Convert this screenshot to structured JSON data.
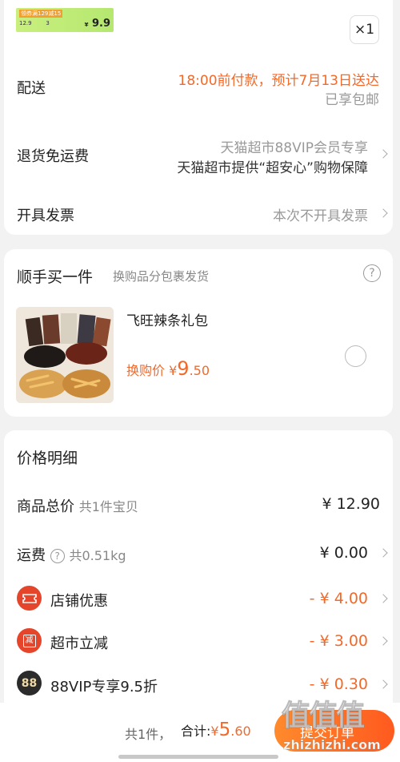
{
  "thumb": {
    "promo": "领券满129减15",
    "price_hint": "12.9",
    "qty_hint": "3",
    "price": "9.9",
    "currency": "¥"
  },
  "quantity": "×1",
  "delivery": {
    "label": "配送",
    "time": "18:00前付款，预计7月13日送达",
    "shipping": "已享包邮"
  },
  "returns": {
    "label": "退货免运费",
    "line1": "天猫超市88VIP会员专享",
    "line2": "天猫超市提供“超安心”购物保障"
  },
  "invoice": {
    "label": "开具发票",
    "value": "本次不开具发票"
  },
  "addon": {
    "title": "顺手买一件",
    "subtitle": "换购品分包裹发货",
    "help": "?",
    "product_name": "飞旺辣条礼包",
    "price_label": "换购价",
    "currency": "¥",
    "price_int": "9",
    "price_dec": ".50"
  },
  "price_detail": {
    "title": "价格明细",
    "rows": [
      {
        "label": "商品总价",
        "sub": "共1件宝贝",
        "amount": "¥ 12.90"
      },
      {
        "label": "运费",
        "sub": "共0.51kg",
        "amount": "¥ 0.00"
      },
      {
        "label": "店铺优惠",
        "sub": "",
        "amount": "- ¥ 4.00"
      },
      {
        "label": "超市立减",
        "sub": "",
        "amount": "- ¥ 3.00"
      },
      {
        "label": "88VIP专享9.5折",
        "sub": "",
        "amount": "- ¥ 0.30"
      }
    ],
    "badge_store": "券",
    "badge_market": "减",
    "badge_vip": "88"
  },
  "footer": {
    "count": "共1件，",
    "total_label": "合计:",
    "currency": "¥",
    "total_int": "5",
    "total_dec": ".60",
    "submit": "提交订单"
  },
  "watermark": {
    "big": "值值值",
    "small": "zhizhizhi.com"
  },
  "colors": {
    "accent": "#f2692a",
    "submit_start": "#ff8a2c",
    "submit_end": "#ff5a1f",
    "vip_badge": "#2b2b2b",
    "coupon_badge": "#e5452a"
  }
}
